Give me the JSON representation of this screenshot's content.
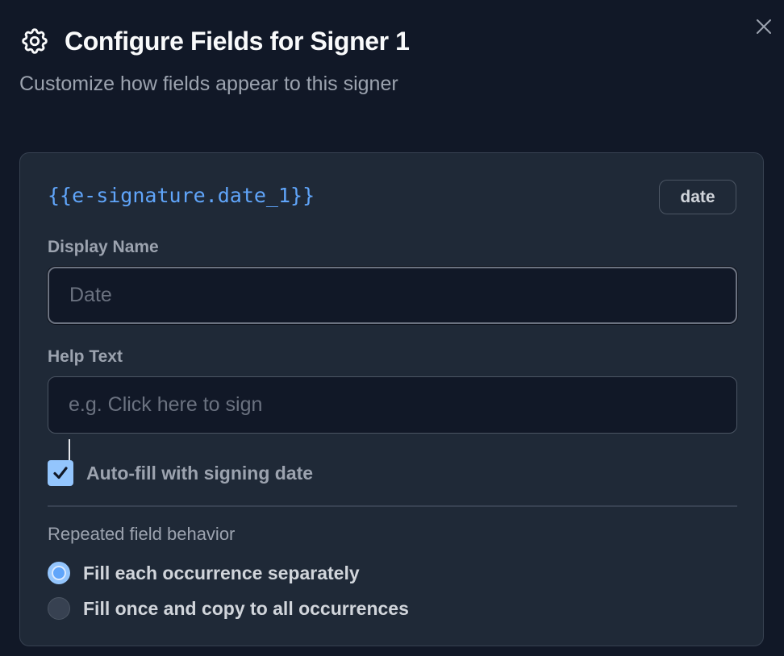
{
  "dialog": {
    "title": "Configure Fields for Signer 1",
    "subtitle": "Customize how fields appear to this signer",
    "icon": "gear-icon",
    "close_icon": "close-icon"
  },
  "field": {
    "tag": "{{e-signature.date_1}}",
    "type_badge": "date",
    "display_name": {
      "label": "Display Name",
      "value": "",
      "placeholder": "Date"
    },
    "help_text": {
      "label": "Help Text",
      "value": "",
      "placeholder": "e.g. Click here to sign"
    },
    "autofill": {
      "label": "Auto-fill with signing date",
      "checked": true
    },
    "repeated": {
      "label": "Repeated field behavior",
      "options": [
        {
          "label": "Fill each occurrence separately",
          "selected": true
        },
        {
          "label": "Fill once and copy to all occurrences",
          "selected": false
        }
      ]
    }
  },
  "colors": {
    "background": "#111827",
    "card": "#1f2937",
    "accent": "#60a5fa",
    "checkbox": "#93c5fd"
  }
}
